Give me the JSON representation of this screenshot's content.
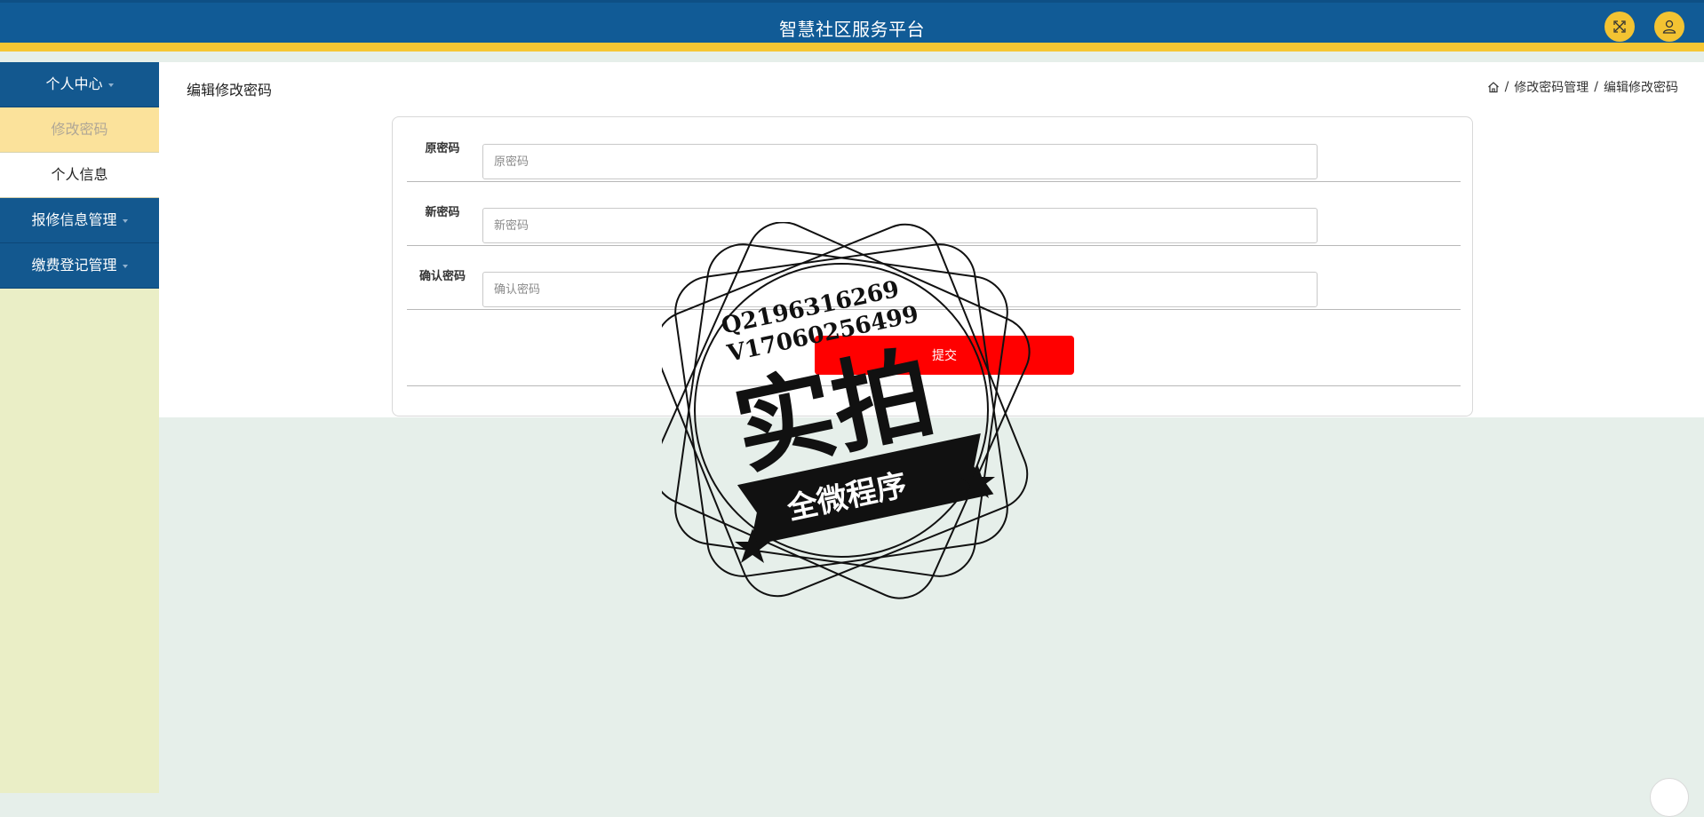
{
  "header": {
    "title": "智慧社区服务平台",
    "fullscreen_icon": "fullscreen-icon",
    "user_icon": "user-icon",
    "accent": "#f6c633",
    "brand": "#115b96"
  },
  "sidebar": {
    "menus": [
      {
        "label": "个人中心",
        "children": [
          {
            "label": "修改密码",
            "active": true
          },
          {
            "label": "个人信息",
            "active": false
          }
        ]
      },
      {
        "label": "报修信息管理",
        "children": []
      },
      {
        "label": "缴费登记管理",
        "children": []
      }
    ]
  },
  "page": {
    "title": "编辑修改密码",
    "breadcrumb": [
      "修改密码管理",
      "编辑修改密码"
    ],
    "breadcrumb_sep": "/"
  },
  "form": {
    "fields": [
      {
        "label": "原密码",
        "placeholder": "原密码",
        "value": ""
      },
      {
        "label": "新密码",
        "placeholder": "新密码",
        "value": ""
      },
      {
        "label": "确认密码",
        "placeholder": "确认密码",
        "value": ""
      }
    ],
    "submit_label": "提交",
    "submit_color": "#ff0000"
  },
  "watermark": {
    "line1": "Q2196316269",
    "line2": "V17060256499",
    "main": "实拍",
    "ribbon": "全微程序"
  }
}
